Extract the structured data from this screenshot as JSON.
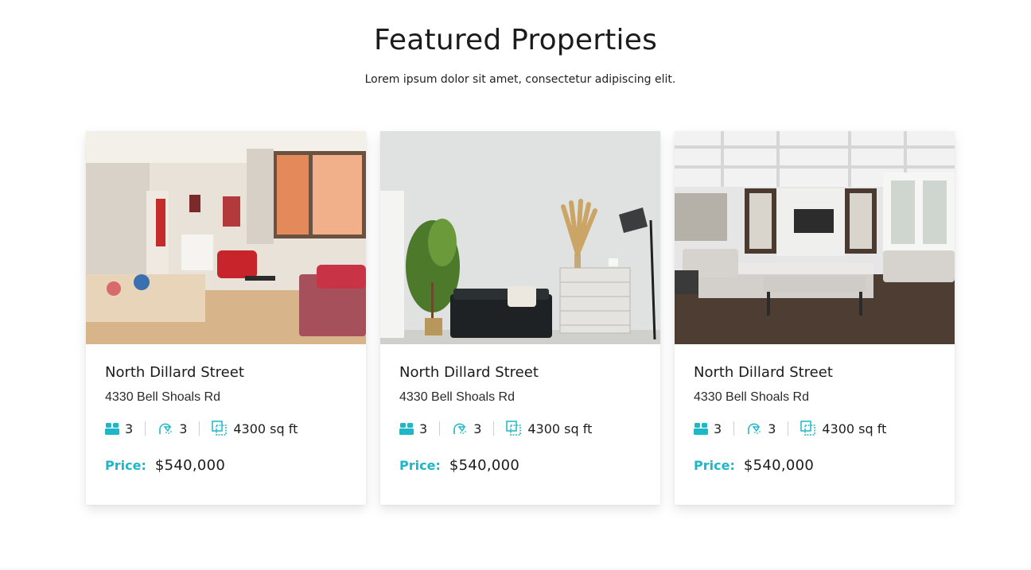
{
  "section": {
    "title": "Featured Properties",
    "subtitle": "Lorem ipsum dolor sit amet, consectetur adipiscing elit."
  },
  "colors": {
    "accent": "#1cb8c7",
    "text": "#1b1b1b"
  },
  "properties": [
    {
      "photo": "living-room-with-red-sofa-photo",
      "title": "North Dillard Street",
      "address": "4330 Bell Shoals Rd",
      "beds": "3",
      "baths": "3",
      "area": "4300 sq ft",
      "price_label": "Price:",
      "price": "$540,000"
    },
    {
      "photo": "living-room-with-black-sofa-photo",
      "title": "North Dillard Street",
      "address": "4330 Bell Shoals Rd",
      "beds": "3",
      "baths": "3",
      "area": "4300 sq ft",
      "price_label": "Price:",
      "price": "$540,000"
    },
    {
      "photo": "luxury-living-room-photo",
      "title": "North Dillard Street",
      "address": "4330 Bell Shoals Rd",
      "beds": "3",
      "baths": "3",
      "area": "4300 sq ft",
      "price_label": "Price:",
      "price": "$540,000"
    }
  ]
}
